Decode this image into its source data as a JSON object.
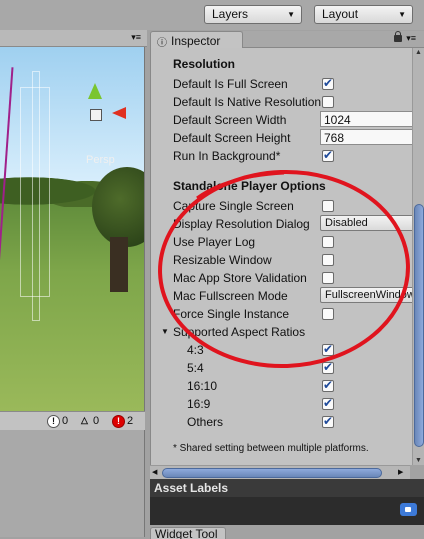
{
  "toolbar": {
    "layers_label": "Layers",
    "layout_label": "Layout"
  },
  "scene": {
    "persp_label": "Persp"
  },
  "console": {
    "info_count": "0",
    "warning_count": "0",
    "error_count": "2"
  },
  "inspector": {
    "tab_label": "Inspector",
    "resolution": {
      "title": "Resolution",
      "rows": [
        {
          "label": "Default Is Full Screen",
          "checked": true
        },
        {
          "label": "Default Is Native Resolution",
          "checked": false
        }
      ],
      "screen_width_label": "Default Screen Width",
      "screen_width_value": "1024",
      "screen_height_label": "Default Screen Height",
      "screen_height_value": "768",
      "run_in_background_label": "Run In Background*",
      "run_in_background_checked": true
    },
    "standalone": {
      "title": "Standalone Player Options",
      "capture_single_screen": "Capture Single Screen",
      "display_resolution_dialog": "Display Resolution Dialog",
      "display_resolution_value": "Disabled",
      "use_player_log": "Use Player Log",
      "resizable_window": "Resizable Window",
      "mac_app_store_validation": "Mac App Store Validation",
      "mac_fullscreen_mode": "Mac Fullscreen Mode",
      "mac_fullscreen_value": "FullscreenWindow",
      "force_single_instance": "Force Single Instance",
      "supported_aspect_ratios": "Supported Aspect Ratios",
      "ratios": [
        "4:3",
        "5:4",
        "16:10",
        "16:9",
        "Others"
      ]
    },
    "footnote": "* Shared setting between multiple platforms."
  },
  "asset_labels": {
    "title": "Asset Labels"
  },
  "bottom_tab": {
    "label": "Widget Tool"
  },
  "colors": {
    "annotation": "#e0141e",
    "check": "#1f4a9a",
    "scroll_thumb": "#7a96c8"
  }
}
